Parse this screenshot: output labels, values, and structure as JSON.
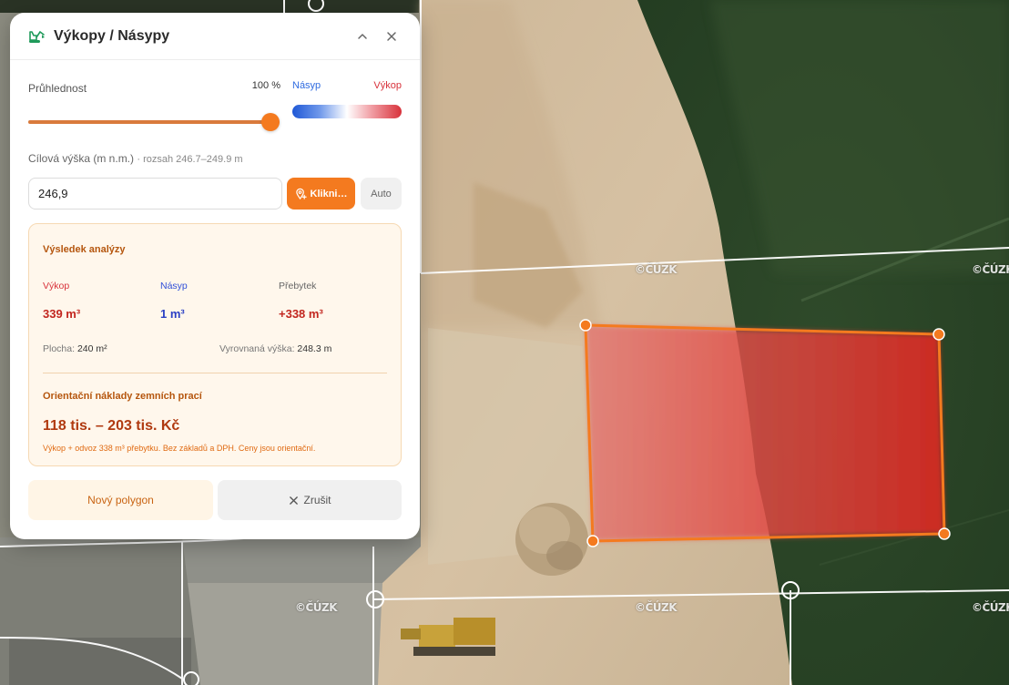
{
  "panel": {
    "title": "Výkopy / Násypy",
    "header_icon": "excavator-icon",
    "collapse_icon": "chevron-up-icon",
    "close_icon": "close-icon"
  },
  "opacity": {
    "label": "Průhlednost",
    "value_text": "100 %",
    "value": 1.0
  },
  "legend": {
    "left_label": "Násyp",
    "right_label": "Výkop",
    "left_color": "#2f6be0",
    "right_color": "#d8323b"
  },
  "target": {
    "label": "Cílová výška (m n.m.)",
    "range_text": "· rozsah 246.7–249.9 m",
    "input_value": "246,9",
    "click_button_label": "Klikni…",
    "click_button_icon": "map-pin-plus-icon",
    "auto_button_label": "Auto"
  },
  "result": {
    "title": "Výsledek analýzy",
    "cut_label": "Výkop",
    "cut_value": "339 m³",
    "fill_label": "Násyp",
    "fill_value": "1 m³",
    "surplus_label": "Přebytek",
    "surplus_value": "+338 m³",
    "area_label": "Plocha:",
    "area_value": "240 m²",
    "level_label": "Vyrovnaná výška:",
    "level_value": "248.3 m",
    "cost_title": "Orientační náklady zemních prací",
    "cost_value": "118 tis. – 203 tis. Kč",
    "cost_note": "Výkop + odvoz 338 m³ přebytku. Bez základů a DPH. Ceny jsou orientační."
  },
  "buttons": {
    "new_polygon": "Nový polygon",
    "cancel": "Zrušit",
    "cancel_icon": "x-icon"
  },
  "colors": {
    "accent": "#f47a1f",
    "cut_red": "#d8323b",
    "fill_blue": "#2f4fd8",
    "polygon_stroke": "#f47a1f"
  },
  "map": {
    "watermark": "©ČÚZK"
  }
}
